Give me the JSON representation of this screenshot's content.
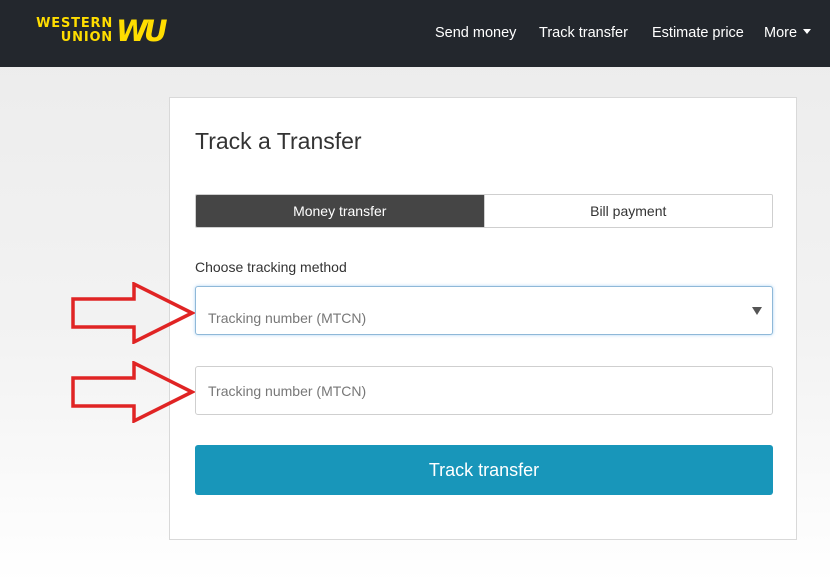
{
  "brand": {
    "logo_line1": "WESTERN",
    "logo_line2": "UNION",
    "logo_mark": "WU",
    "logo_color": "#ffdd00"
  },
  "nav": {
    "items": [
      "Send money",
      "Track transfer",
      "Estimate price",
      "More"
    ]
  },
  "card": {
    "title": "Track a Transfer",
    "tabs": [
      {
        "label": "Money transfer",
        "active": true
      },
      {
        "label": "Bill payment",
        "active": false
      }
    ],
    "method_label": "Choose tracking method",
    "method_select_value": "Tracking number (MTCN)",
    "tracking_input_value": "",
    "tracking_input_placeholder": "Tracking number (MTCN)",
    "submit_label": "Track transfer"
  },
  "colors": {
    "navbar": "#23272d",
    "active_tab": "#454545",
    "primary_button": "#1896ba",
    "annotation_arrow": "#e02424"
  },
  "annotations": {
    "arrow_icon": "red-outline-right-arrow"
  }
}
